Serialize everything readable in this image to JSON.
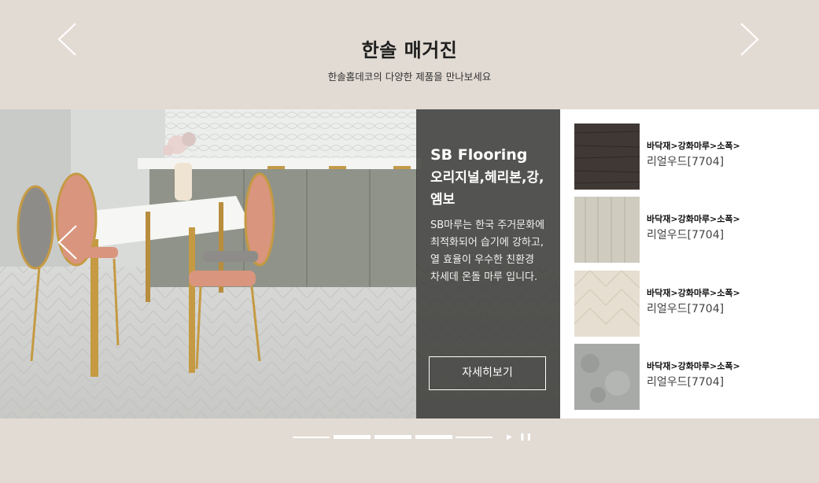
{
  "header": {
    "title": "한솔 매거진",
    "subtitle": "한솔홈데코의 다양한 제품을 만나보세요"
  },
  "hero": {
    "brand": "SB Flooring",
    "subtitle": "오리지널,헤리본,강,엠보",
    "description": "SB마루는 한국 주거문화에 최적화되어 습기에 강하고, 열 효율이 우수한 친환경 차세데 온돌 마루 입니다.",
    "button_label": "자세히보기"
  },
  "products": [
    {
      "category": "바닥재>강화마루>소폭>",
      "name": "리얼우드[7704]",
      "swatch_color": "#3f3834"
    },
    {
      "category": "바닥재>강화마루>소폭>",
      "name": "리얼우드[7704]",
      "swatch_color": "#cfcbbf"
    },
    {
      "category": "바닥재>강화마루>소폭>",
      "name": "리얼우드[7704]",
      "swatch_color": "#e6ded0"
    },
    {
      "category": "바닥재>강화마루>소폭>",
      "name": "리얼우드[7704]",
      "swatch_color": "#a8aaa8"
    }
  ],
  "pager": {
    "slide_count": 5,
    "active_slides": [
      1,
      2,
      3
    ],
    "play_icon": "play-icon",
    "pause_icon": "pause-icon"
  },
  "colors": {
    "background": "#e2dbd3",
    "overlay": "#2d2d2a",
    "panel": "#ffffff"
  }
}
